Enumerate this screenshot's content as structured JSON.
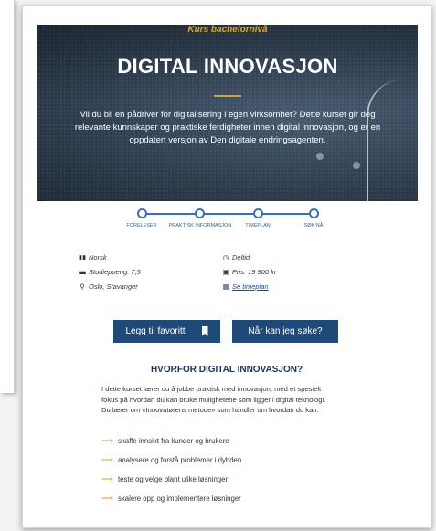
{
  "hero": {
    "kicker": "Kurs bachelornivå",
    "title": "DIGITAL INNOVASJON",
    "description": "Vil du bli en pådriver for digitalisering i egen virksomhet? Dette kurset gir deg relevante kunnskaper og praktiske ferdigheter innen digital innovasjon, og er en oppdatert versjon av Den digitale endringsagenten."
  },
  "steps": [
    {
      "label": "FORELESER",
      "icon": "step-dot"
    },
    {
      "label": "PRAKTISK INFORMASJON",
      "icon": "step-dot"
    },
    {
      "label": "TIMEPLAN",
      "icon": "step-dot"
    },
    {
      "label": "SØK NÅ",
      "icon": "step-dot"
    }
  ],
  "info": {
    "language": {
      "icon": "flag-icon",
      "text": "Norsk"
    },
    "credits": {
      "icon": "book-icon",
      "text": "Studiepoeng: 7,5"
    },
    "location": {
      "icon": "map-pin-icon",
      "text": "Oslo, Stavanger"
    },
    "pace": {
      "icon": "clock-icon",
      "text": "Deltid"
    },
    "price": {
      "icon": "money-icon",
      "text": "Pris: 19 900 kr"
    },
    "schedule": {
      "icon": "calendar-icon",
      "text": "Se timeplan"
    }
  },
  "buttons": {
    "favorite_label": "Legg til favoritt",
    "apply_label": "Når kan jeg søke?"
  },
  "why": {
    "title": "HVORFOR DIGITAL INNOVASJON?",
    "lines": [
      "I dette kurset lærer du å jobbe praktisk med innovasjon, med et spesielt",
      "fokus på hvordan du kan bruke mulighetene som ligger i digital teknologi.",
      "Du lærer om «Innovatørens metode» som handler om hvordan du kan:"
    ],
    "bullets": [
      "skaffe innsikt fra kunder og brukere",
      "analysere og forstå problemer i dybden",
      "teste og velge blant ulike løsninger",
      "skalere opp og implementere løsninger"
    ]
  },
  "colors": {
    "primary": "#1f4a78",
    "accent": "#d39b2b",
    "kicker": "#d8a836"
  }
}
